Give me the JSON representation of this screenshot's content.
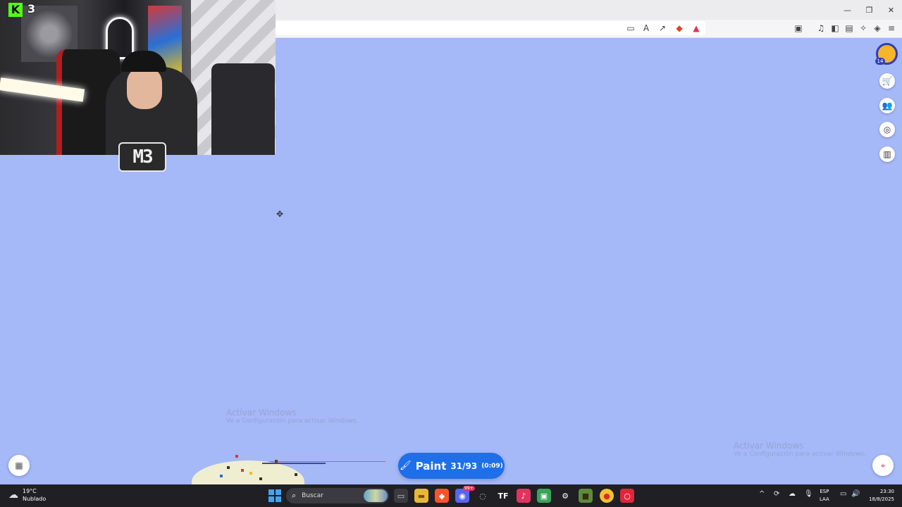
{
  "stream": {
    "platform_logo": "K",
    "viewer_count": "3",
    "logo_text": "M3"
  },
  "browser": {
    "window_controls": [
      "minimize-icon",
      "maximize-icon",
      "close-icon"
    ],
    "toolbar_icons": [
      "cast-icon",
      "translate-icon",
      "share-icon",
      "brave-shield-icon",
      "brave-rewards-icon",
      "tab-manager-icon",
      "music-icon",
      "sidebar-icon",
      "wallet-icon",
      "leo-ai-icon",
      "vpn-icon",
      "menu-icon"
    ]
  },
  "side_panel": {
    "avatar_level": "14",
    "buttons": [
      "store-icon",
      "friends-icon",
      "explore-icon",
      "leaderboard-icon"
    ]
  },
  "watermark": {
    "title": "Activar Windows",
    "subtitle": "Ve a Configuración para activar Windows."
  },
  "paint_button": {
    "label": "Paint",
    "count": "31/93",
    "timer": "(0:09)"
  },
  "taskbar": {
    "weather_temp": "19°C",
    "weather_desc": "Nublado",
    "search_placeholder": "Buscar",
    "lang_line1": "ESP",
    "lang_line2": "LAA",
    "time": "23:30",
    "date": "18/8/2025",
    "discord_badge": "99+"
  },
  "colors": {
    "canvas_bg": "#a5b8f8",
    "paint_button": "#1e6fe8",
    "taskbar": "#1f1f24",
    "kick_green": "#53fc18"
  }
}
